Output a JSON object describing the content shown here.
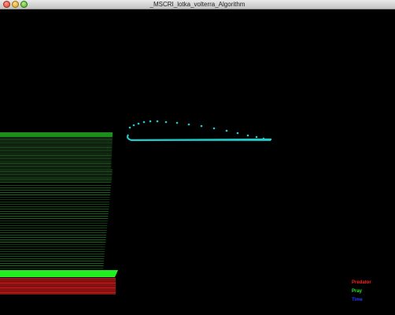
{
  "window": {
    "title": "_MSCRI_lotka_volterra_Algorithm"
  },
  "legend": {
    "predator_label": "Predator",
    "prey_label": "Pray",
    "time_label": "Time",
    "predator_color": "#ff2020",
    "prey_color": "#22ee22",
    "time_color": "#2a3cff"
  },
  "colors": {
    "background": "#000000",
    "phase_curve": "#22cccc"
  }
}
